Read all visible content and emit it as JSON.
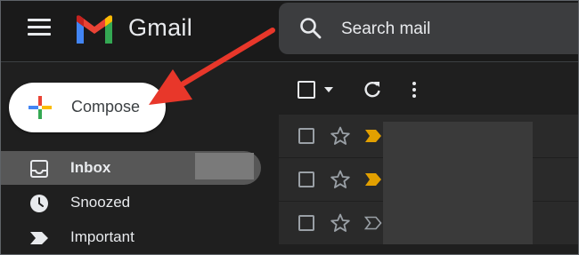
{
  "header": {
    "brand": "Gmail",
    "search": {
      "placeholder": "Search mail"
    }
  },
  "compose": {
    "label": "Compose"
  },
  "sidebar": {
    "items": [
      {
        "label": "Inbox",
        "icon": "inbox-icon",
        "active": true
      },
      {
        "label": "Snoozed",
        "icon": "clock-icon",
        "active": false
      },
      {
        "label": "Important",
        "icon": "label-important-icon",
        "active": false
      }
    ]
  },
  "toolbar": {
    "icons": [
      "select-all-checkbox",
      "chevron-down-icon",
      "refresh-icon",
      "more-vert-icon"
    ]
  },
  "rows": [
    {
      "starred": false,
      "important": true
    },
    {
      "starred": false,
      "important": true
    },
    {
      "starred": false,
      "important": false
    }
  ],
  "colors": {
    "important": "#e2a000",
    "arrow": "#e8372a",
    "background": "#1f1f1f",
    "active_nav": "#575757"
  }
}
